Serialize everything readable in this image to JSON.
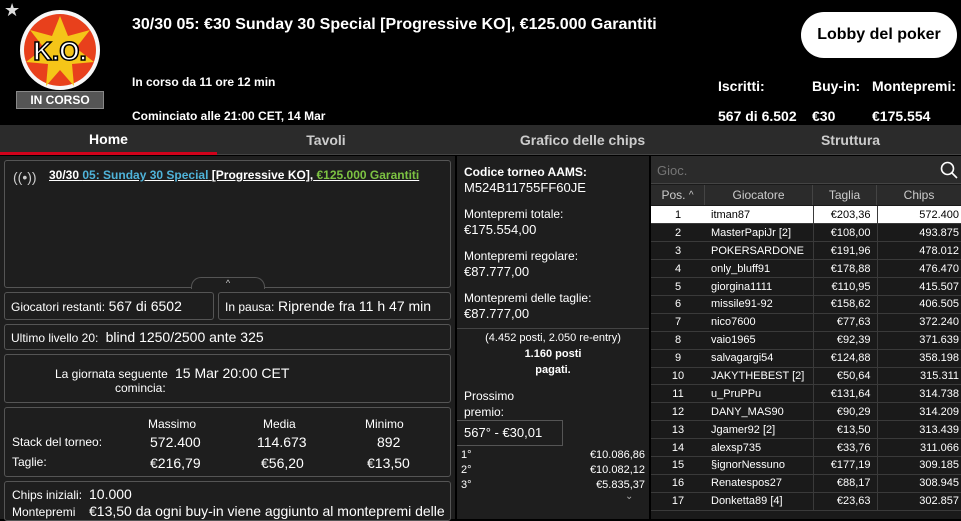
{
  "header": {
    "title": "30/30 05: €30 Sunday 30 Special [Progressive KO], €125.000 Garantiti",
    "logo_text": "K.O.",
    "status_badge": "IN CORSO",
    "running_time": "In corso da 11 ore 12 min",
    "started": "Cominciato alle 21:00 CET, 14 Mar",
    "lobby_button": "Lobby del poker",
    "registered_label": "Iscritti:",
    "registered_value": "567 di 6.502",
    "buyin_label": "Buy-in:",
    "buyin_value": "€30",
    "prize_label": "Montepremi:",
    "prize_value": "€175.554"
  },
  "tabs": [
    "Home",
    "Tavoli",
    "Grafico delle chips",
    "Struttura"
  ],
  "info": {
    "tourney_prefix": "30/30",
    "tourney_name": "05: Sunday 30 Special",
    "tourney_ko": "[Progressive KO],",
    "tourney_guarantee": "€125.000 Garantiti",
    "players_left_label": "Giocatori restanti:",
    "players_left_value": "567 di 6502",
    "pause_label": "In pausa:",
    "pause_value": "Riprende fra 11 h 47 min",
    "last_level_label": "Ultimo livello 20:",
    "last_level_value": "blind 1250/2500 ante 325",
    "next_day_label_1": "La giornata seguente",
    "next_day_label_2": "comincia:",
    "next_day_value": "15 Mar 20:00 CET",
    "stats_head": [
      "Massimo",
      "Media",
      "Minimo"
    ],
    "stack_label": "Stack del torneo:",
    "stack_values": [
      "572.400",
      "114.673",
      "892"
    ],
    "bounty_label": "Taglie:",
    "bounty_values": [
      "€216,79",
      "€56,20",
      "€13,50"
    ],
    "initial_chips_label": "Chips iniziali:",
    "initial_chips_value": "10.000",
    "prize_note_label": "Montepremi",
    "prize_note_value": "€13,50 da ogni buy-in viene aggiunto al montepremi delle"
  },
  "middle": {
    "aams_label": "Codice torneo AAMS:",
    "aams_value": "M524B11755FF60JE",
    "total_label": "Montepremi totale:",
    "total_value": "€175.554,00",
    "regular_label": "Montepremi regolare:",
    "regular_value": "€87.777,00",
    "bounty_label": "Montepremi delle taglie:",
    "bounty_value": "€87.777,00",
    "entries_line1": "(4.452 posti, 2.050 re-entry)",
    "entries_line2": "1.160 posti",
    "entries_line3": "pagati.",
    "next_prize_label_1": "Prossimo",
    "next_prize_label_2": "premio:",
    "next_prize_value": "567° - €30,01",
    "payouts": [
      {
        "pos": "1°",
        "amount": "€10.086,86"
      },
      {
        "pos": "2°",
        "amount": "€10.082,12"
      },
      {
        "pos": "3°",
        "amount": "€5.835,37"
      }
    ]
  },
  "ranking": {
    "search_placeholder": "Gioc.",
    "headers": [
      "Pos.",
      "Giocatore",
      "Taglia",
      "Chips"
    ],
    "rows": [
      [
        "1",
        "itman87",
        "€203,36",
        "572.400"
      ],
      [
        "2",
        "MasterPapiJr [2]",
        "€108,00",
        "493.875"
      ],
      [
        "3",
        "POKERSARDONE",
        "€191,96",
        "478.012"
      ],
      [
        "4",
        "only_bluff91",
        "€178,88",
        "476.470"
      ],
      [
        "5",
        "giorgina1111",
        "€110,95",
        "415.507"
      ],
      [
        "6",
        "missile91-92",
        "€158,62",
        "406.505"
      ],
      [
        "7",
        "nico7600",
        "€77,63",
        "372.240"
      ],
      [
        "8",
        "vaio1965",
        "€92,39",
        "371.639"
      ],
      [
        "9",
        "salvagargi54",
        "€124,88",
        "358.198"
      ],
      [
        "10",
        "JAKYTHEBEST [2]",
        "€50,64",
        "315.311"
      ],
      [
        "11",
        "u_PruPPu",
        "€131,64",
        "314.738"
      ],
      [
        "12",
        "DANY_MAS90",
        "€90,29",
        "314.209"
      ],
      [
        "13",
        "Jgamer92 [2]",
        "€13,50",
        "313.439"
      ],
      [
        "14",
        "alexsp735",
        "€33,76",
        "311.066"
      ],
      [
        "15",
        "§ignorNessuno",
        "€177,19",
        "309.185"
      ],
      [
        "16",
        "Renatespos27",
        "€88,17",
        "308.945"
      ],
      [
        "17",
        "Donketta89 [4]",
        "€23,63",
        "302.857"
      ]
    ]
  }
}
